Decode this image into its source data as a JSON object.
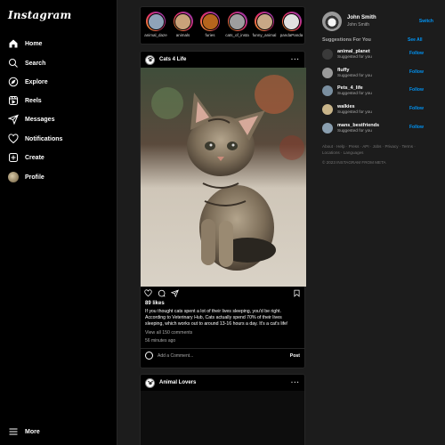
{
  "app": {
    "logo": "Instagram"
  },
  "nav": [
    {
      "label": "Home",
      "icon": "home-icon"
    },
    {
      "label": "Search",
      "icon": "search-icon"
    },
    {
      "label": "Explore",
      "icon": "compass-icon"
    },
    {
      "label": "Reels",
      "icon": "reels-icon"
    },
    {
      "label": "Messages",
      "icon": "send-icon"
    },
    {
      "label": "Notifications",
      "icon": "heart-icon"
    },
    {
      "label": "Create",
      "icon": "plus-square-icon"
    },
    {
      "label": "Profile",
      "icon": "avatar"
    }
  ],
  "more": {
    "label": "More",
    "icon": "menu-icon"
  },
  "stories": [
    {
      "name": "animal_daze",
      "color": "#8fa3b8"
    },
    {
      "name": "animals",
      "color": "#c9a27a"
    },
    {
      "name": "furies",
      "color": "#b5651d"
    },
    {
      "name": "cats_of_insta",
      "color": "#9e9e9e"
    },
    {
      "name": "funny_animal",
      "color": "#c8a886"
    },
    {
      "name": "pandaPanda",
      "color": "#e0e0e0"
    }
  ],
  "post1": {
    "username": "Cats 4 Life",
    "likes": "89 likes",
    "caption": "If you thought cats spent a lot of their lives sleeping, you'd be right. According to Veterinary Hub, Cats actually spend 70% of their lives sleeping, which works out to around 13-16 hours a day. It's a cat's life!",
    "view_comments": "View all 150 comments",
    "time": "56 minutes ago",
    "comment_placeholder": "Add a Comment...",
    "post_label": "Post"
  },
  "post2": {
    "username": "Animal Lovers"
  },
  "me": {
    "username": "John Smith",
    "name": "John Smith",
    "switch_label": "Switch"
  },
  "suggestions": {
    "title": "Suggestions For You",
    "see_all": "See All",
    "items": [
      {
        "username": "animal_planet",
        "sub": "Suggested for you",
        "follow": "Follow",
        "color": "#3a3a3a"
      },
      {
        "username": "fluffy",
        "sub": "Suggested for you",
        "follow": "Follow",
        "color": "#9a9a9a"
      },
      {
        "username": "Pets_4_life",
        "sub": "Suggested for you",
        "follow": "Follow",
        "color": "#7a8fa0"
      },
      {
        "username": "walkies",
        "sub": "Suggested for you",
        "follow": "Follow",
        "color": "#c9b58a"
      },
      {
        "username": "mans_bestfriends",
        "sub": "Suggested for you",
        "follow": "Follow",
        "color": "#8a9fb0"
      }
    ]
  },
  "footer": {
    "links": "About · Help · Press · API · Jobs · Privacy · Terms · Locations · Languages",
    "copyright": "© 2023 INSTAGRAM FROM META"
  }
}
